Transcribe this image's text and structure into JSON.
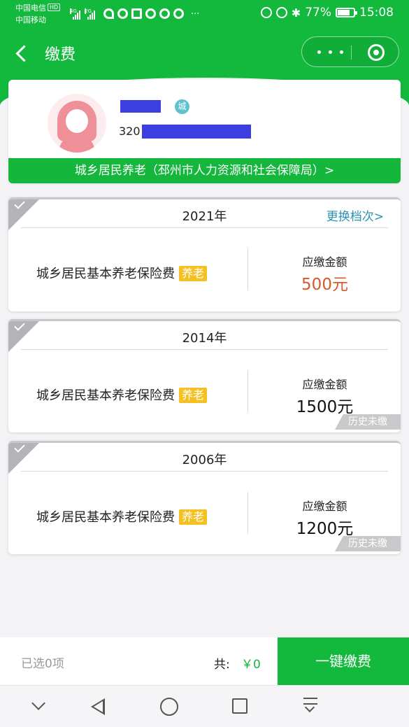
{
  "status_bar": {
    "carrier_1": "中国电信",
    "hd_badge": "HD",
    "carrier_2": "中国移动",
    "signal_1_tag": "4G",
    "signal_2_tag": "2G",
    "more": "···",
    "battery_percent": "77%",
    "time": "15:08",
    "battery_level": 0.77
  },
  "header": {
    "title": "缴费"
  },
  "profile": {
    "city_badge": "城",
    "id_prefix": "320",
    "organization": "城乡居民养老（邳州市人力资源和社会保障局）>"
  },
  "payments": [
    {
      "year": "2021年",
      "change_link": "更换档次>",
      "item": "城乡居民基本养老保险费",
      "tag": "养老",
      "due_label": "应缴金额",
      "amount": "500元",
      "history_badge": ""
    },
    {
      "year": "2014年",
      "item": "城乡居民基本养老保险费",
      "tag": "养老",
      "due_label": "应缴金额",
      "amount": "1500元",
      "history_badge": "历史未缴"
    },
    {
      "year": "2006年",
      "item": "城乡居民基本养老保险费",
      "tag": "养老",
      "due_label": "应缴金额",
      "amount": "1200元",
      "history_badge": "历史未缴"
    }
  ],
  "footer": {
    "selected": "已选0项",
    "total_label": "共:",
    "total_value": "￥0",
    "pay_button": "一键缴费"
  },
  "colors": {
    "brand_green": "#12b93c",
    "amount_red": "#d55a27",
    "link_blue": "#2b91b5",
    "tag_yellow": "#f5c021"
  }
}
